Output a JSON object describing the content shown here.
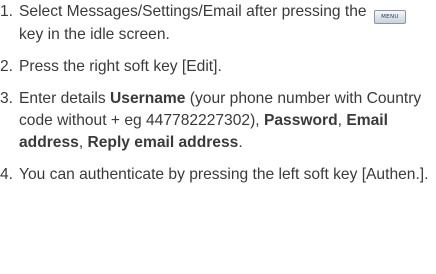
{
  "steps": [
    {
      "number": "1.",
      "text_before_key": "Select Messages/Settings/Email after pressing the",
      "key_label": "MENU",
      "text_after_key": "key in the idle screen."
    },
    {
      "number": "2.",
      "text": "Press the right soft key [Edit]."
    },
    {
      "number": "3.",
      "intro": "Enter details",
      "field_username": "Username",
      "username_note": "(your phone number with Country code without + eg 447782227302),",
      "field_password": "Password",
      "field_email": "Email address",
      "field_reply_email": "Reply email address",
      "separator": ",",
      "end": "."
    },
    {
      "number": "4.",
      "text": "You can authenticate by pressing the left soft key [Authen.]."
    }
  ]
}
